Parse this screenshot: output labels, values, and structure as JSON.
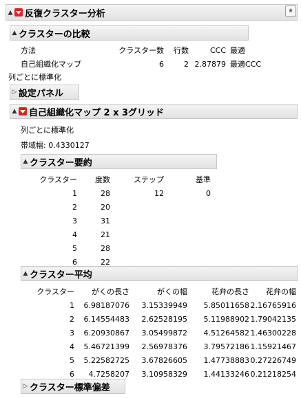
{
  "main_title": "反復クラスター分析",
  "compare": {
    "title": "クラスターの比較",
    "headers": [
      "方法",
      "クラスター数",
      "行数",
      "CCC",
      "最適"
    ],
    "row": [
      "自己組織化マップ",
      "6",
      "2",
      "2.87879",
      "最適CCC"
    ]
  },
  "note1": "列ごとに標準化",
  "settings_title": "設定パネル",
  "som": {
    "title": "自己組織化マップ 2 x 3グリッド",
    "note": "列ごとに標準化",
    "bandwidth": "帯域幅:  0.4330127"
  },
  "summary": {
    "title": "クラスター要約",
    "headers": [
      "クラスター",
      "度数",
      "ステップ",
      "基準"
    ],
    "rows": [
      [
        "1",
        "28",
        "12",
        "0"
      ],
      [
        "2",
        "20",
        "",
        ""
      ],
      [
        "3",
        "31",
        "",
        ""
      ],
      [
        "4",
        "21",
        "",
        ""
      ],
      [
        "5",
        "28",
        "",
        ""
      ],
      [
        "6",
        "22",
        "",
        ""
      ]
    ]
  },
  "means": {
    "title": "クラスター平均",
    "headers": [
      "クラスター",
      "がくの長さ",
      "がくの幅",
      "花弁の長さ",
      "花弁の幅"
    ],
    "rows": [
      [
        "1",
        "6.98187076",
        "3.15339949",
        "5.85011658",
        "2.16765916"
      ],
      [
        "2",
        "6.14554483",
        "2.62528195",
        "5.11988902",
        "1.79042135"
      ],
      [
        "3",
        "6.20930867",
        "3.05499872",
        "4.51264582",
        "1.46300228"
      ],
      [
        "4",
        "5.46721399",
        "2.56978376",
        "3.79572186",
        "1.15921467"
      ],
      [
        "5",
        "5.22582725",
        "3.67826605",
        "1.47738883",
        "0.27226749"
      ],
      [
        "6",
        "4.7258207",
        "3.10958329",
        "1.44133246",
        "0.21218254"
      ]
    ]
  },
  "stddev_title": "クラスター標準偏差",
  "icons": {
    "disclosure_open": "▲",
    "disclosure_closed": "▷"
  }
}
